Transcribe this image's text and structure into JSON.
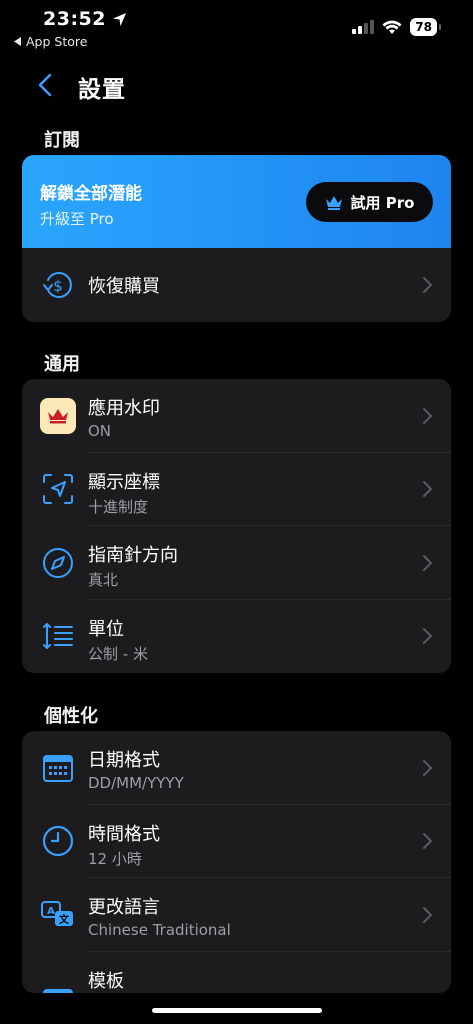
{
  "status_bar": {
    "time": "23:52",
    "back_app": "App Store",
    "battery": "78"
  },
  "nav": {
    "title": "設置"
  },
  "sections": {
    "subscription": "訂閱",
    "general": "通用",
    "personalize": "個性化"
  },
  "promo": {
    "title": "解鎖全部潛能",
    "subtitle": "升級至 Pro",
    "button": "試用 Pro"
  },
  "restore": {
    "title": "恢復購買"
  },
  "general_items": [
    {
      "title": "應用水印",
      "sub": "ON",
      "icon": "watermark-crown-icon"
    },
    {
      "title": "顯示座標",
      "sub": "十進制度",
      "icon": "location-scan-icon"
    },
    {
      "title": "指南針方向",
      "sub": "真北",
      "icon": "compass-icon"
    },
    {
      "title": "單位",
      "sub": "公制 - 米",
      "icon": "units-list-icon"
    }
  ],
  "personal_items": [
    {
      "title": "日期格式",
      "sub": "DD/MM/YYYY",
      "icon": "calendar-icon"
    },
    {
      "title": "時間格式",
      "sub": "12 小時",
      "icon": "clock-icon"
    },
    {
      "title": "更改語言",
      "sub": "Chinese Traditional",
      "icon": "translate-icon"
    },
    {
      "title": "模板",
      "sub": "",
      "icon": "template-icon"
    }
  ],
  "colors": {
    "accent": "#3aa0ff",
    "card": "#1c1c1e",
    "promo_start": "#2aa6ff",
    "promo_end": "#1e84f0"
  }
}
